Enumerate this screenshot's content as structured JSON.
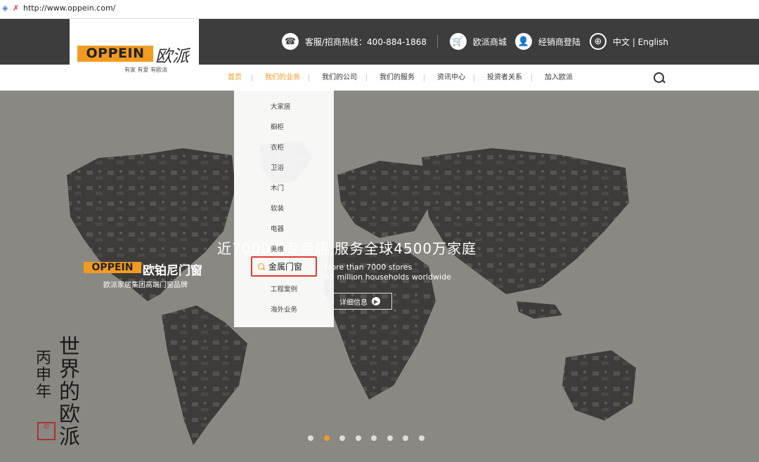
{
  "browser": {
    "url": "http://www.oppein.com/"
  },
  "header": {
    "logo_text": "OPPEIN",
    "logo_cn": "欧派",
    "slogan": "有家 有爱 有欧派",
    "hotline_label": "客服/招商热线：400-884-1868",
    "mall_label": "欧派商城",
    "dealer_label": "经销商登陆",
    "language_label": "中文 | English",
    "icons": [
      "phone-icon",
      "cart-icon",
      "user-icon",
      "globe-icon"
    ]
  },
  "nav": {
    "items": [
      "首页",
      "我们的业务",
      "我们的公司",
      "我们的服务",
      "资讯中心",
      "投资者关系",
      "加入欧派"
    ],
    "active_index": 0,
    "hover_index": 1
  },
  "dropdown": {
    "items": [
      "大家居",
      "橱柜",
      "衣柜",
      "卫浴",
      "木门",
      "软装",
      "电器",
      "奥维",
      "金属门窗",
      "工程案例",
      "海外业务"
    ],
    "highlighted": "金属门窗"
  },
  "hero": {
    "headline": "近7000家专卖店,服务全球4500万家庭",
    "sub_line1": "More than 7000 stores",
    "sub_line2": "45 million households worldwide",
    "detail_button": "详细信息",
    "brand_logo_text": "OPPEIN",
    "brand_cn": "欧铂尼门窗",
    "brand_sub": "欧派家居集团高端门窗品牌",
    "calligraphy_main": "世界的欧派",
    "calligraphy_date": "丙申年",
    "slide_count": 8,
    "active_slide": 1
  },
  "colors": {
    "brand_orange": "#f29b21",
    "topbar": "#3d3d3d",
    "highlight_border": "#e03b2c"
  }
}
